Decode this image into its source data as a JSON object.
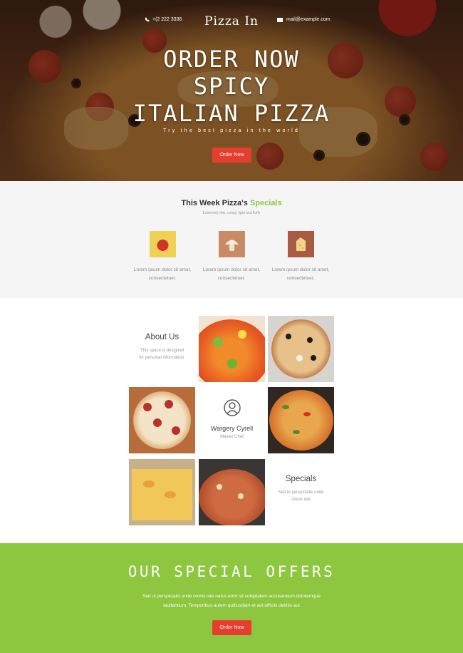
{
  "header": {
    "phone": "+(2 222 3336",
    "brand": "Pizza In",
    "email": "mail@example.com"
  },
  "hero": {
    "headline": [
      "ORDER NOW",
      "SPICY",
      "ITALIAN PIZZA"
    ],
    "tagline": "Try the best pizza in the world",
    "button": "Order Now"
  },
  "specials": {
    "title_prefix": "This Week Pizza's",
    "title_accent": "Specials",
    "subtitle": "Extremely thin, crispy, light and fluffy",
    "items": [
      {
        "icon": "tomato-icon",
        "text": "Lorem ipsum dolor sit amet, consectetuer.",
        "bg": "#f0d155"
      },
      {
        "icon": "mushroom-icon",
        "text": "Lorem ipsum dolor sit amet, consectetuer.",
        "bg": "#c98a66"
      },
      {
        "icon": "cheese-icon",
        "text": "Lorem ipsum dolor sit amet, consectetuer.",
        "bg": "#a85a44"
      }
    ]
  },
  "grid": {
    "about": {
      "title": "About Us",
      "text1": "This space is designed",
      "text2": "for personal information."
    },
    "chef": {
      "name": "Wargery Cyrell",
      "role": "Master Chef"
    },
    "specials": {
      "title": "Specials",
      "text1": "Sed ut perspiciatis unde",
      "text2": "omnis iste"
    }
  },
  "offers": {
    "title": "OUR SPECIAL OFFERS",
    "text": "Sed ut perspiciatis unde omnis iste natus error sit voluptatem accusantium doloremque laudantium. Temporibus autem quibusdam et aut officiis debitis aut",
    "button": "Order Now"
  },
  "colors": {
    "accent": "#8dc63f",
    "button": "#e63d2f"
  }
}
